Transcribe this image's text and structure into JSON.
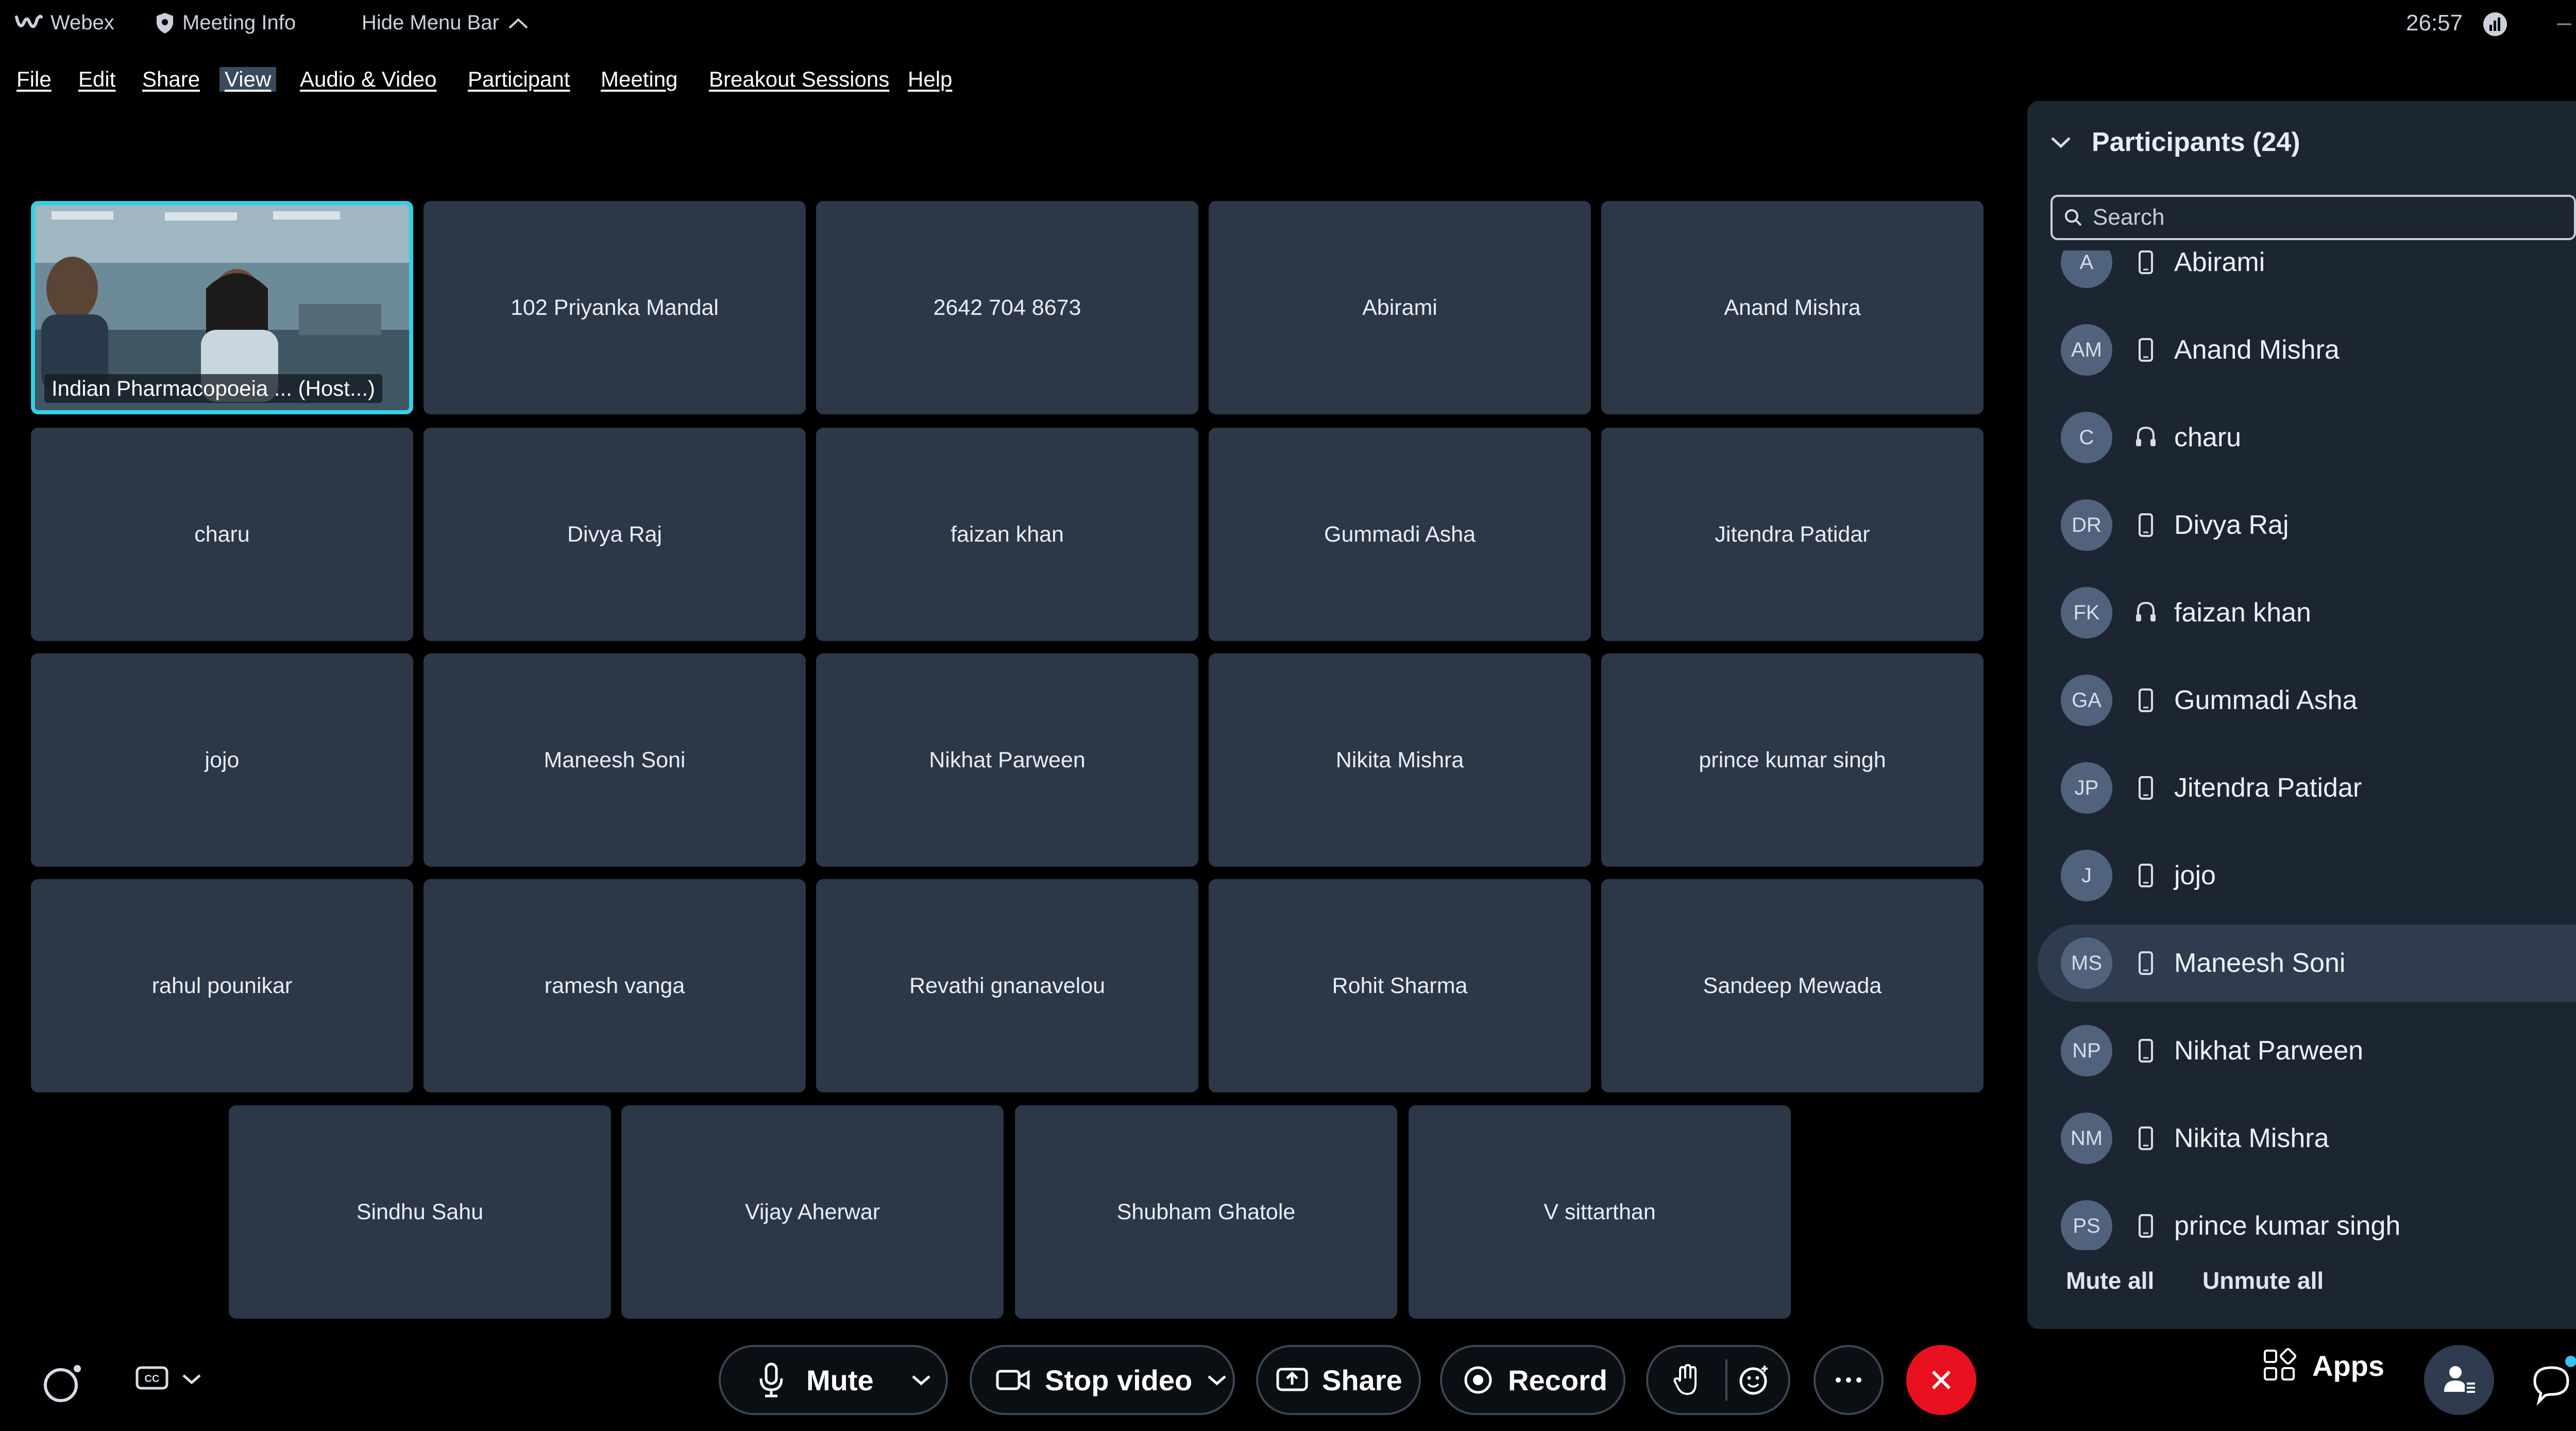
{
  "titlebar": {
    "app_name": "Webex",
    "meeting_info": "Meeting Info",
    "hide_menu_bar": "Hide Menu Bar",
    "clock": "26:57"
  },
  "menu": [
    "File",
    "Edit",
    "Share",
    "View",
    "Audio & Video",
    "Participant",
    "Meeting",
    "Breakout Sessions",
    "Help"
  ],
  "active_menu": "View",
  "grid": {
    "self_label": "Indian Pharmacopoeia ... (Host...)",
    "tiles": [
      "102 Priyanka Mandal",
      "2642 704 8673",
      "Abirami",
      "Anand Mishra",
      "charu",
      "Divya Raj",
      "faizan khan",
      "Gummadi Asha",
      "Jitendra Patidar",
      "jojo",
      "Maneesh Soni",
      "Nikhat Parween",
      "Nikita Mishra",
      "prince kumar singh",
      "rahul pounikar",
      "ramesh vanga",
      "Revathi gnanavelou",
      "Rohit Sharma",
      "Sandeep Mewada",
      "Sindhu Sahu",
      "Vijay Aherwar",
      "Shubham Ghatole",
      "V sittarthan"
    ]
  },
  "panel": {
    "title": "Participants (24)",
    "search_placeholder": "Search",
    "participants": [
      {
        "initials": "A",
        "name": "Abirami",
        "device": "phone",
        "muted": true
      },
      {
        "initials": "AM",
        "name": "Anand Mishra",
        "device": "phone",
        "muted": true
      },
      {
        "initials": "C",
        "name": "charu",
        "device": "headset",
        "muted": false
      },
      {
        "initials": "DR",
        "name": "Divya Raj",
        "device": "phone",
        "muted": true
      },
      {
        "initials": "FK",
        "name": "faizan khan",
        "device": "headset",
        "muted": true
      },
      {
        "initials": "GA",
        "name": "Gummadi Asha",
        "device": "phone",
        "muted": true
      },
      {
        "initials": "JP",
        "name": "Jitendra Patidar",
        "device": "phone",
        "muted": true
      },
      {
        "initials": "J",
        "name": "jojo",
        "device": "phone",
        "muted": true
      },
      {
        "initials": "MS",
        "name": "Maneesh Soni",
        "device": "phone",
        "muted": true,
        "highlighted": true
      },
      {
        "initials": "NP",
        "name": "Nikhat Parween",
        "device": "phone",
        "muted": true
      },
      {
        "initials": "NM",
        "name": "Nikita Mishra",
        "device": "phone",
        "muted": true
      },
      {
        "initials": "PS",
        "name": "prince kumar singh",
        "device": "phone",
        "muted": true
      }
    ],
    "mute_all": "Mute all",
    "unmute_all": "Unmute all"
  },
  "controls": {
    "mute": "Mute",
    "stop_video": "Stop video",
    "share": "Share",
    "record": "Record",
    "apps": "Apps"
  },
  "colors": {
    "tile_bg": "#2c3747",
    "panel_bg": "#1c2633",
    "active_speaker_border": "#34d0e6",
    "leave_red": "#e8101e",
    "mic_off_pink": "#d9779b",
    "chat_badge": "#31c4f3"
  }
}
